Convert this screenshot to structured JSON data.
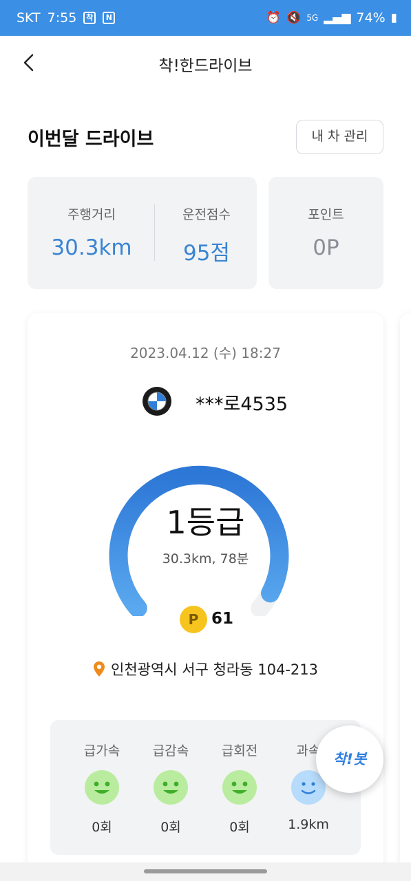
{
  "status_bar": {
    "carrier": "SKT",
    "time": "7:55",
    "battery": "74%",
    "network": "5G",
    "color": "#3b8fe4"
  },
  "header": {
    "title": "착!한드라이브"
  },
  "summary": {
    "title": "이번달 드라이브",
    "manage_label": "내 차 관리",
    "distance_label": "주행거리",
    "distance_value": "30.3km",
    "score_label": "운전점수",
    "score_value": "95점",
    "points_label": "포인트",
    "points_value": "0P"
  },
  "drive": {
    "date": "2023.04.12 (수) 18:27",
    "plate": "***로4535",
    "grade": "1등급",
    "distance_time": "30.3km, 78분",
    "earned_points": "61",
    "point_badge": "P",
    "location": "인천광역시 서구 청라동 104-213",
    "gauge_fill_fraction": 0.95,
    "events": [
      {
        "label": "급가속",
        "value": "0회",
        "face": "green"
      },
      {
        "label": "급감속",
        "value": "0회",
        "face": "green"
      },
      {
        "label": "급회전",
        "value": "0회",
        "face": "green"
      },
      {
        "label": "과속",
        "value": "1.9km",
        "face": "blue"
      }
    ]
  },
  "chatbot": {
    "label": "착!봇"
  },
  "colors": {
    "accent": "#3a85d2",
    "gauge_start": "#5aa8ef",
    "gauge_end": "#2d77d6",
    "face_green": "#b9ec9e",
    "face_blue": "#b7dbfb",
    "point_gold": "#f7c41f"
  }
}
